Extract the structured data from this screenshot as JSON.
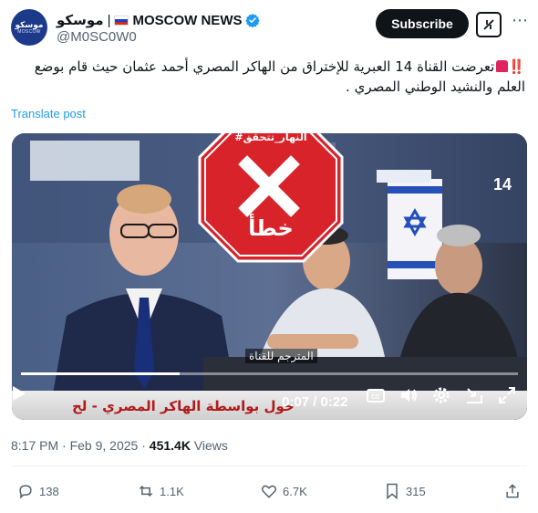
{
  "account": {
    "display_name_arabic": "موسكو",
    "separator": "|",
    "display_name_english": "MOSCOW NEWS",
    "handle": "@M0SC0W0",
    "avatar_text_arabic": "موسكو",
    "avatar_text_english": "MOSCOW",
    "verified": true
  },
  "header": {
    "subscribe_label": "Subscribe",
    "grok_icon": "grok-icon",
    "more_icon": "more-icon"
  },
  "tweet": {
    "emojis": "‼️",
    "text": "تعرضت القناة 14 العبرية للإختراق من الهاكر المصري أحمد عثمان حيث قام بوضع العلم والنشيد الوطني المصري .",
    "translate_label": "Translate post"
  },
  "video": {
    "stamp_hashtag": "#النهار_تتحقق",
    "stamp_verdict": "خطأ",
    "subtitle_text": "المترجم للقناة",
    "ticker_text": "حول بواسطة الهاكر المصري - لح",
    "channel_number": "14",
    "current_time": "0:07",
    "total_time": "0:22",
    "time_display": "0:07 / 0:22",
    "progress": 0.32
  },
  "meta": {
    "time": "8:17 PM",
    "dot": "·",
    "date": "Feb 9, 2025",
    "views_count": "451.4K",
    "views_label": "Views"
  },
  "actions": {
    "replies": "138",
    "reposts": "1.1K",
    "likes": "6.7K",
    "bookmarks": "315"
  },
  "colors": {
    "accent": "#1d9bf0",
    "verified": "#1d9bf0",
    "stamp_red": "#d8232a",
    "text": "#0f1419",
    "muted": "#536471"
  }
}
